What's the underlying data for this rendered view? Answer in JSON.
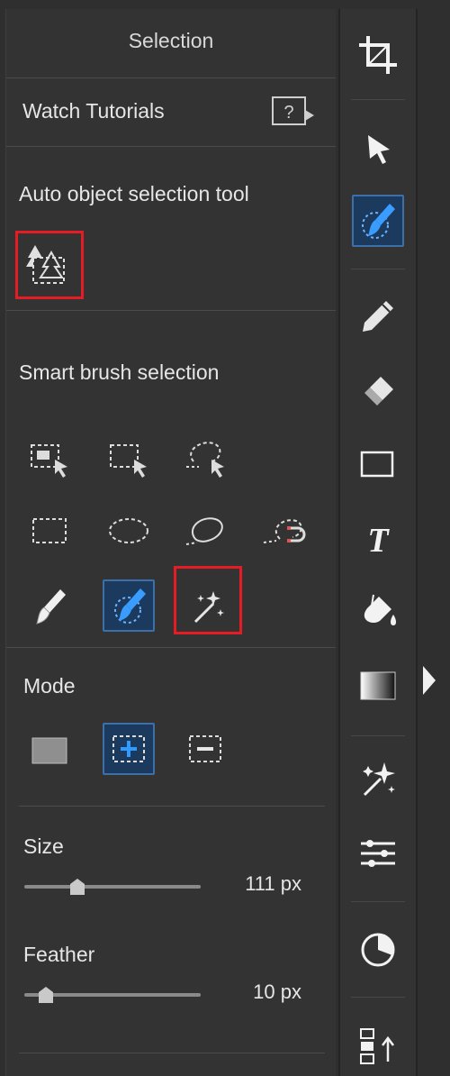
{
  "panel": {
    "title": "Selection",
    "watch_tutorials_label": "Watch Tutorials",
    "auto_object": {
      "heading": "Auto object selection tool"
    },
    "smart_brush": {
      "heading": "Smart brush selection"
    },
    "mode": {
      "heading": "Mode"
    },
    "size": {
      "label": "Size",
      "value": "111 px",
      "fraction": 0.3
    },
    "feather": {
      "label": "Feather",
      "value": "10 px",
      "fraction": 0.12
    }
  },
  "colors": {
    "panel_bg": "#333333",
    "selected_bg": "#1c3a5e",
    "accent": "#2f8fe8",
    "highlight_red": "#e51c23"
  },
  "icons": {
    "toolbar": [
      "crop-icon",
      "pointer-arrow-icon",
      "quick-selection-brush-icon",
      "pencil-icon",
      "eraser-icon",
      "rectangle-icon",
      "text-icon",
      "paint-bucket-icon",
      "gradient-icon",
      "magic-wand-stars-icon",
      "adjustments-sliders-icon",
      "color-circle-icon",
      "arrange-icon"
    ]
  }
}
